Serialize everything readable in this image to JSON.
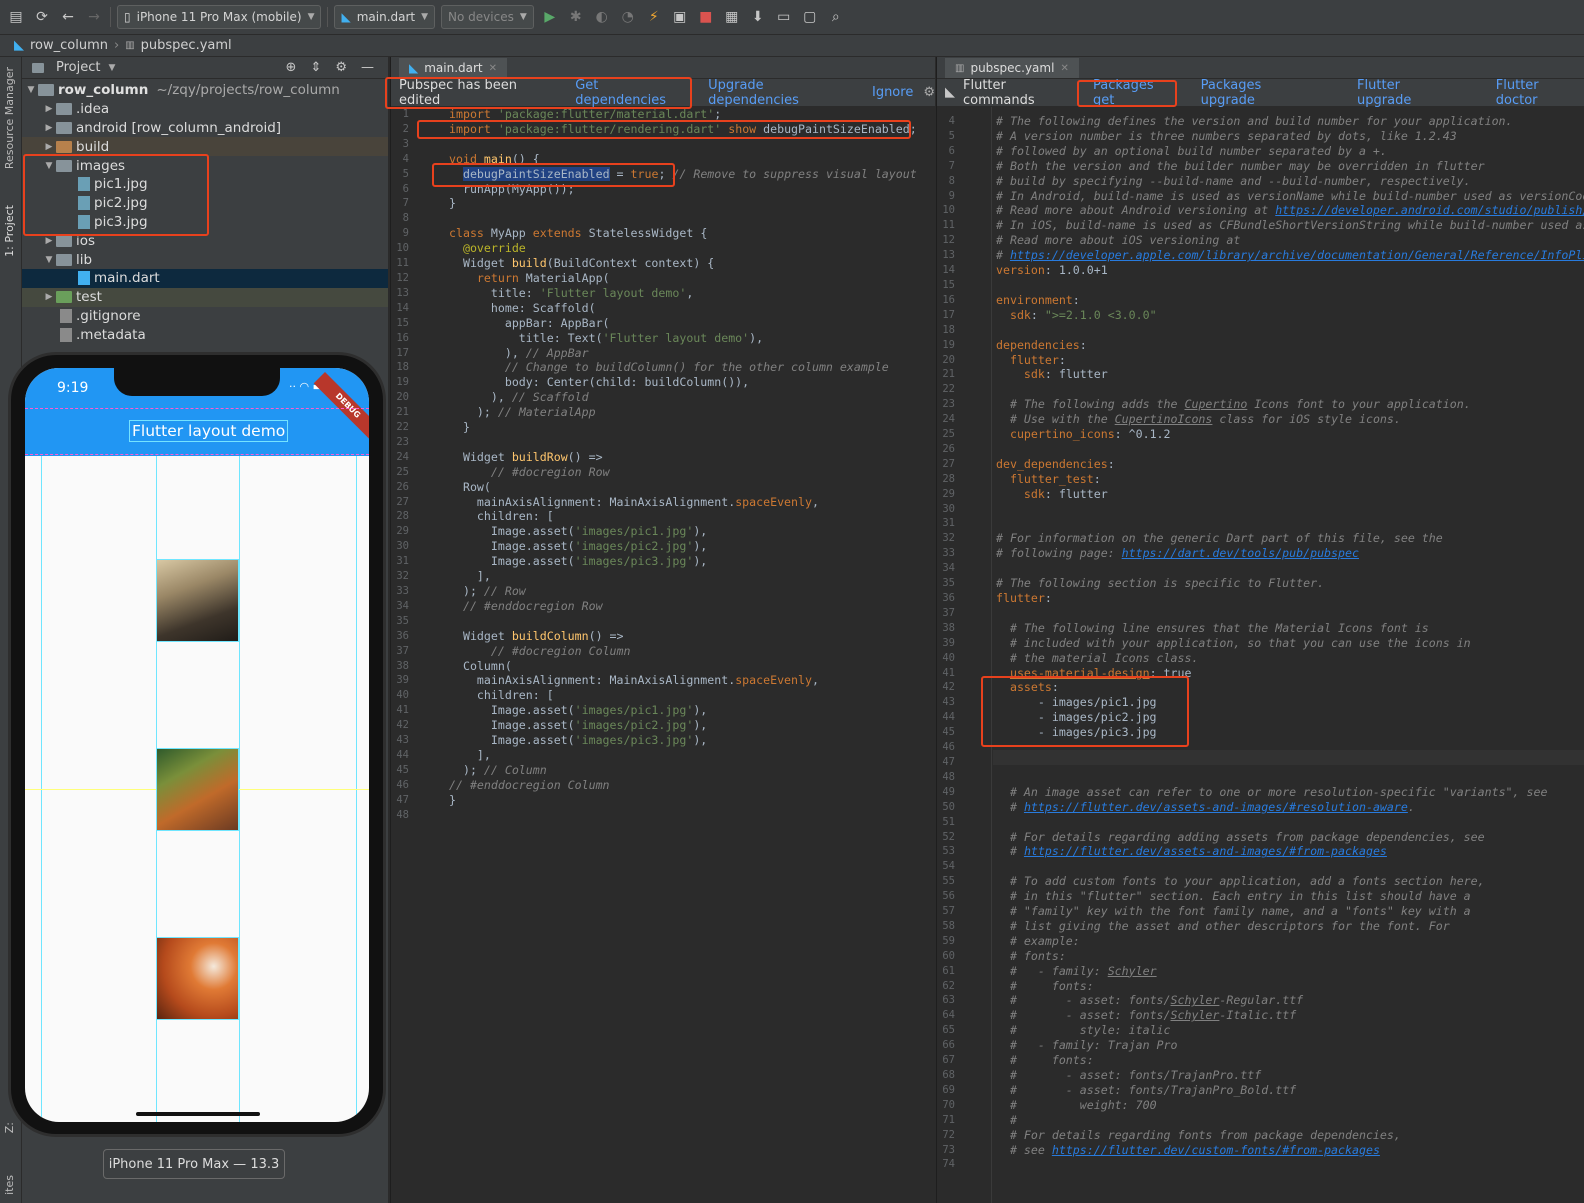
{
  "toolbar": {
    "device": "iPhone 11 Pro Max (mobile)",
    "file": "main.dart",
    "devices": "No devices"
  },
  "breadcrumb": {
    "project": "row_column",
    "file": "pubspec.yaml"
  },
  "sidestrip": {
    "resource_manager": "Resource Manager",
    "project": "1: Project",
    "z": "Z:",
    "bottom": "ites"
  },
  "project_panel": {
    "title": "Project",
    "tree": [
      {
        "label": "row_column",
        "suffix": "~/zqy/projects/row_column"
      },
      {
        "label": ".idea"
      },
      {
        "label": "android [row_column_android]"
      },
      {
        "label": "build"
      },
      {
        "label": "images"
      },
      {
        "label": "pic1.jpg"
      },
      {
        "label": "pic2.jpg"
      },
      {
        "label": "pic3.jpg"
      },
      {
        "label": "ios"
      },
      {
        "label": "lib"
      },
      {
        "label": "main.dart"
      },
      {
        "label": "test"
      },
      {
        "label": ".gitignore"
      },
      {
        "label": ".metadata"
      }
    ]
  },
  "simulator": {
    "time": "9:19",
    "app_title": "Flutter layout demo",
    "banner": "DEBUG",
    "device_label": "iPhone 11 Pro Max — 13.3"
  },
  "main_editor": {
    "tab": "main.dart",
    "notice": "Pubspec has been edited",
    "get_deps": "Get dependencies",
    "upgrade_deps": "Upgrade dependencies",
    "ignore": "Ignore"
  },
  "pubspec_editor": {
    "tab": "pubspec.yaml",
    "commands_label": "Flutter commands",
    "packages_get": "Packages get",
    "packages_upgrade": "Packages upgrade",
    "flutter_upgrade": "Flutter upgrade",
    "flutter_doctor": "Flutter doctor"
  }
}
